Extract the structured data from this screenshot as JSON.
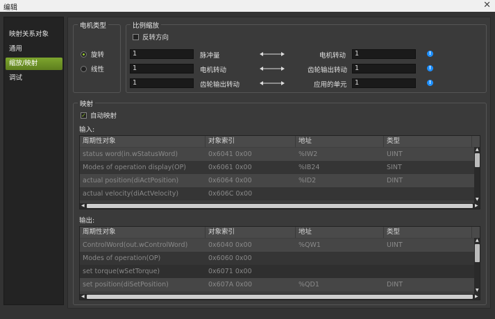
{
  "window": {
    "title": "编辑",
    "close_glyph": "✕"
  },
  "sidebar": {
    "items": [
      {
        "label": "映射关系对象",
        "selected": false
      },
      {
        "label": "通用",
        "selected": false
      },
      {
        "label": "缩放/映射",
        "selected": true
      },
      {
        "label": "调试",
        "selected": false
      }
    ]
  },
  "motor_type": {
    "legend": "电机类型",
    "options": [
      {
        "label": "旋转",
        "checked": true
      },
      {
        "label": "线性",
        "checked": false
      }
    ]
  },
  "scaling": {
    "legend": "比例缩放",
    "reverse_label": "反转方向",
    "reverse_checked": false,
    "rows": [
      {
        "left_value": "1",
        "left_label": "脉冲量",
        "right_label": "电机转动",
        "right_value": "1"
      },
      {
        "left_value": "1",
        "left_label": "电机转动",
        "right_label": "齿轮输出转动",
        "right_value": "1"
      },
      {
        "left_value": "1",
        "left_label": "齿轮输出转动",
        "right_label": "应用的单元",
        "right_value": "1"
      }
    ],
    "info_icon": "!"
  },
  "mapping": {
    "legend": "映射",
    "auto_label": "自动映射",
    "auto_checked": true,
    "input_label": "输入:",
    "output_label": "输出:",
    "columns": [
      "周期性对象",
      "对象索引",
      "地址",
      "类型"
    ],
    "inputs": [
      [
        "status word(in.wStatusWord)",
        "0x6041 0x00",
        "%IW2",
        "UINT"
      ],
      [
        "Modes of operation display(OP)",
        "0x6061 0x00",
        "%IB24",
        "SINT"
      ],
      [
        "actual position(diActPosition)",
        "0x6064 0x00",
        "%ID2",
        "DINT"
      ],
      [
        "actual velocity(diActVelocity)",
        "0x606C 0x00",
        "",
        ""
      ]
    ],
    "outputs": [
      [
        "ControlWord(out.wControlWord)",
        "0x6040 0x00",
        "%QW1",
        "UINT"
      ],
      [
        "Modes of operation(OP)",
        "0x6060 0x00",
        "",
        ""
      ],
      [
        "set torque(wSetTorque)",
        "0x6071 0x00",
        "",
        ""
      ],
      [
        "set position(diSetPosition)",
        "0x607A 0x00",
        "%QD1",
        "DINT"
      ]
    ]
  }
}
